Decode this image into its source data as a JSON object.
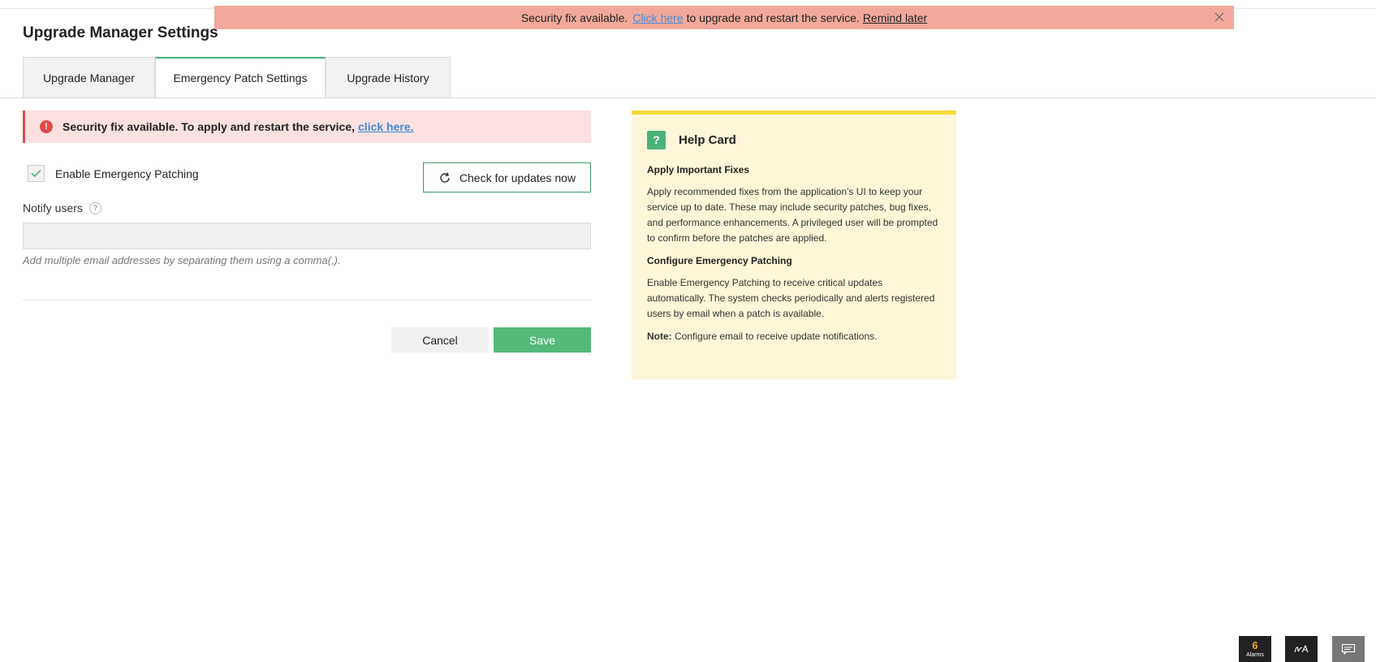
{
  "banner": {
    "prefix": "Security fix available.",
    "link": "Click here",
    "middle": "to upgrade and restart the service.",
    "remind": "Remind later"
  },
  "page_title": "Upgrade Manager Settings",
  "tabs": [
    {
      "label": "Upgrade Manager",
      "active": false
    },
    {
      "label": "Emergency Patch Settings",
      "active": true
    },
    {
      "label": "Upgrade History",
      "active": false
    }
  ],
  "alert": {
    "text": "Security fix available. To apply and restart the service,",
    "link": "click here."
  },
  "form": {
    "enable_label": "Enable Emergency Patching",
    "enable_checked": true,
    "check_button": "Check for updates now",
    "notify_label": "Notify users",
    "notify_value": "",
    "hint": "Add multiple email addresses by separating them using a comma(,).",
    "cancel": "Cancel",
    "save": "Save"
  },
  "help_card": {
    "title": "Help Card",
    "s1_title": "Apply Important Fixes",
    "s1_body": "Apply recommended fixes from the application's UI to keep your service up to date. These may include security patches, bug fixes, and performance enhancements. A privileged user will be prompted to confirm before the patches are applied.",
    "s2_title": "Configure Emergency Patching",
    "s2_body": "Enable Emergency Patching to receive critical updates automatically. The system checks periodically and alerts registered users by email when a patch is available.",
    "note_label": "Note:",
    "note_body": "Configure email to receive update notifications."
  },
  "dock": {
    "alarms_count": "6",
    "alarms_label": "Alarms",
    "icons": [
      "alarms-icon",
      "sign-icon",
      "chat-icon"
    ]
  },
  "colors": {
    "banner_bg": "#f2a99b",
    "alert_bg": "#fde1e1",
    "accent_green": "#56b97c",
    "help_bg": "#fdf6d8",
    "help_border": "#f5d83a"
  }
}
